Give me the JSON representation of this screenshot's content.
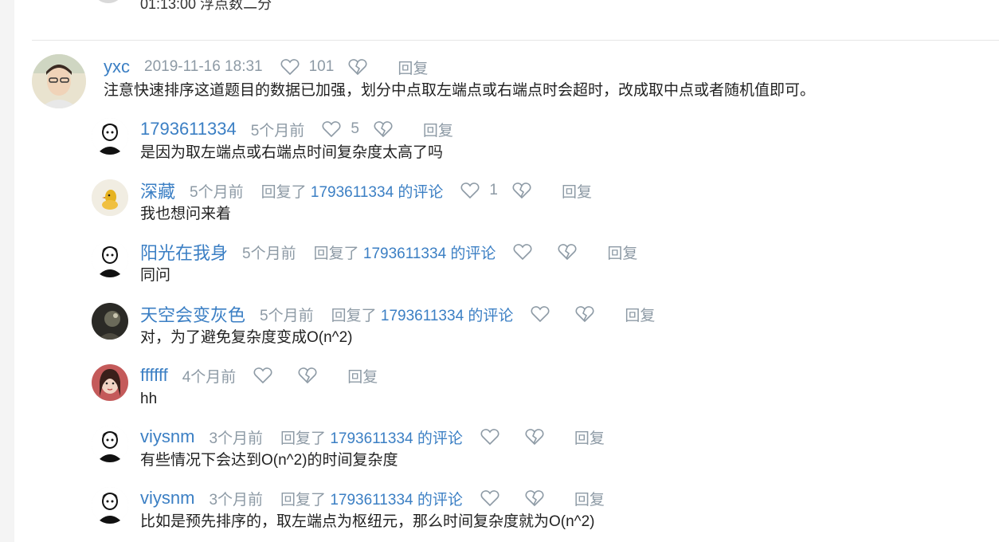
{
  "top_snippet": "01:13:00 浮点数二分",
  "comments": [
    {
      "user": "yxc",
      "time": "2019-11-16 18:31",
      "likes": "101",
      "reply_label": "回复",
      "text": "注意快速排序这道题目的数据已加强，划分中点取左端点或右端点时会超时，改成取中点或者随机值即可。"
    }
  ],
  "replies": [
    {
      "user": "1793611334",
      "time": "5个月前",
      "reply_to": "",
      "likes": "5",
      "reply_label": "回复",
      "text": "是因为取左端点或右端点时间复杂度太高了吗"
    },
    {
      "user": "深藏",
      "time": "5个月前",
      "reply_prefix": "回复了 ",
      "reply_to": "1793611334 的评论",
      "likes": "1",
      "reply_label": "回复",
      "text": "我也想问来着"
    },
    {
      "user": "阳光在我身",
      "time": "5个月前",
      "reply_prefix": "回复了 ",
      "reply_to": "1793611334 的评论",
      "likes": "",
      "reply_label": "回复",
      "text": "同问"
    },
    {
      "user": "天空会变灰色",
      "time": "5个月前",
      "reply_prefix": "回复了 ",
      "reply_to": "1793611334 的评论",
      "likes": "",
      "reply_label": "回复",
      "text": "对，为了避免复杂度变成O(n^2)"
    },
    {
      "user": "ffffff",
      "time": "4个月前",
      "reply_to": "",
      "likes": "",
      "reply_label": "回复",
      "text": "hh"
    },
    {
      "user": "viysnm",
      "time": "3个月前",
      "reply_prefix": "回复了 ",
      "reply_to": "1793611334 的评论",
      "likes": "",
      "reply_label": "回复",
      "text": "有些情况下会达到O(n^2)的时间复杂度"
    },
    {
      "user": "viysnm",
      "time": "3个月前",
      "reply_prefix": "回复了 ",
      "reply_to": "1793611334 的评论",
      "likes": "",
      "reply_label": "回复",
      "text": "比如是预先排序的，取左端点为枢纽元，那么时间复杂度就为O(n^2)"
    }
  ],
  "colors": {
    "link": "#3b7fc4",
    "meta": "#8d9aa5",
    "text": "#222222"
  },
  "icons": {
    "like": "heart-outline-icon",
    "dislike": "broken-heart-icon"
  }
}
